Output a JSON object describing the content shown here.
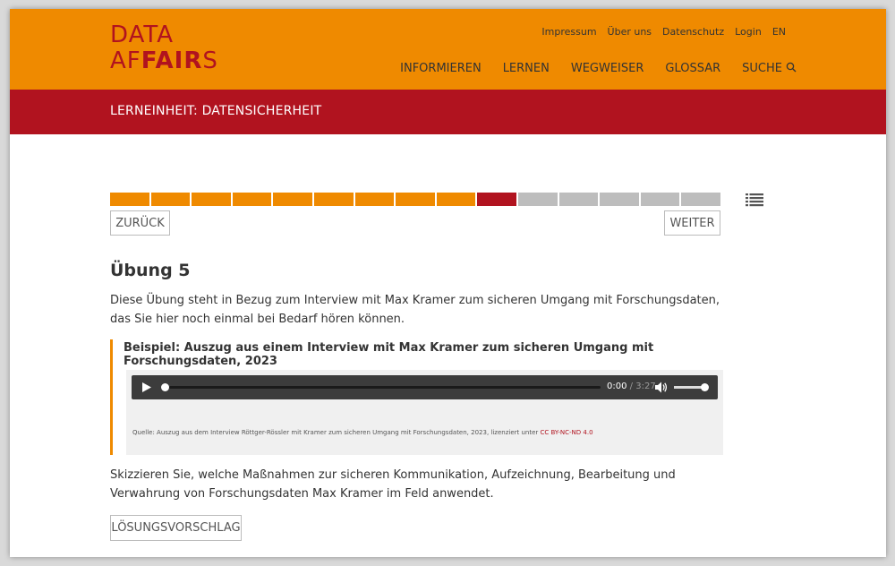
{
  "brand": {
    "logo_line1": "DATA",
    "logo_line2_pre": "AF",
    "logo_line2_bold": "FAIR",
    "logo_line2_post": "S"
  },
  "util_nav": [
    "Impressum",
    "Über uns",
    "Datenschutz",
    "Login",
    "EN"
  ],
  "main_nav": {
    "items": [
      "INFORMIEREN",
      "LERNEN",
      "WEGWEISER",
      "GLOSSAR"
    ],
    "search_label": "SUCHE",
    "search_icon": "magnifier-icon"
  },
  "subheader": {
    "title": "LERNEINHEIT: DATENSICHERHEIT"
  },
  "progress": {
    "total_steps": 15,
    "completed": 9,
    "current": 10,
    "colors": {
      "completed": "#ef8a00",
      "current": "#b1131f",
      "remaining": "#bdbdbd"
    }
  },
  "nav_buttons": {
    "back": "ZURÜCK",
    "next": "WEITER"
  },
  "exercise": {
    "title": "Übung 5",
    "intro": "Diese Übung steht in Bezug zum Interview mit Max Kramer zum sicheren Umgang mit Forschungsdaten, das Sie hier noch einmal bei Bedarf hören können.",
    "example_title": "Beispiel: Auszug aus einem Interview mit Max Kramer zum sicheren Umgang mit Forschungsdaten, 2023",
    "audio": {
      "current_time": "0:00",
      "separator": "/",
      "duration": "3:27",
      "volume": 0.85
    },
    "caption_text": "Quelle: Auszug aus dem Interview Röttger-Rössler mit Kramer zum sicheren Umgang mit Forschungsdaten, 2023, lizenziert unter ",
    "caption_license": "CC BY-NC-ND 4.0",
    "task": "Skizzieren Sie, welche Maßnahmen zur sicheren Kommunikation, Aufzeichnung, Bearbeitung und Verwahrung von Forschungsdaten Max Kramer im Feld anwendet.",
    "solution_button": "LÖSUNGSVORSCHLAG"
  },
  "colors": {
    "orange": "#ef8a00",
    "red": "#b1131f"
  }
}
